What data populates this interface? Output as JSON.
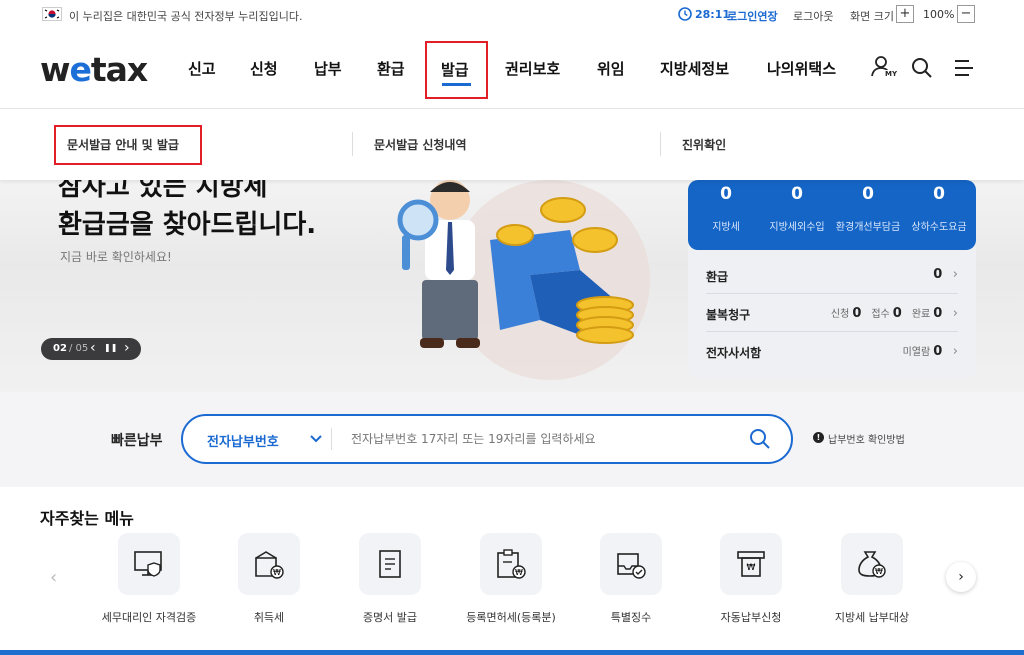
{
  "topbar": {
    "notice": "이 누리집은 대한민국 공식 전자정부 누리집입니다.",
    "timer": "28:11",
    "extend_login": "로그인연장",
    "logout": "로그아웃",
    "zoom_label": "화면 크기",
    "zoom_plus": "+",
    "zoom_value": "100%",
    "zoom_minus": "−"
  },
  "logo": {
    "w": "w",
    "e": "e",
    "tax": "tax"
  },
  "nav": [
    {
      "label": "신고"
    },
    {
      "label": "신청"
    },
    {
      "label": "납부"
    },
    {
      "label": "환급"
    },
    {
      "label": "발급"
    },
    {
      "label": "권리보호"
    },
    {
      "label": "위임"
    },
    {
      "label": "지방세정보"
    },
    {
      "label": "나의위택스"
    }
  ],
  "my_badge": "MY",
  "submenu": [
    {
      "label": "문서발급 안내 및 발급"
    },
    {
      "label": "문서발급 신청내역"
    },
    {
      "label": "진위확인"
    }
  ],
  "hero": {
    "title_top": "잠자고 있는 지방세",
    "title": "환급금을 찾아드립니다.",
    "subtitle": "지금 바로 확인하세요!",
    "slide_current": "02",
    "slide_total": "/ 05",
    "prev": "‹",
    "pause": "❚❚"
  },
  "panel": {
    "counters": [
      {
        "value": "0",
        "label": "지방세"
      },
      {
        "value": "0",
        "label": "지방세외수입"
      },
      {
        "value": "0",
        "label": "환경개선부담금"
      },
      {
        "value": "0",
        "label": "상하수도요금"
      }
    ],
    "refund": {
      "label": "환급",
      "value": "0"
    },
    "appeal": {
      "label": "불복청구",
      "apply_label": "신청",
      "apply": "0",
      "receipt_label": "접수",
      "receipt": "0",
      "done_label": "완료",
      "done": "0"
    },
    "mailbox": {
      "label": "전자사서함",
      "unread_label": "미열람",
      "unread": "0"
    }
  },
  "quickpay": {
    "label": "빠른납부",
    "select": "전자납부번호",
    "placeholder": "전자납부번호 17자리 또는 19자리를 입력하세요",
    "help": "납부번호 확인방법"
  },
  "favorites": {
    "title": "자주찾는 메뉴",
    "items": [
      {
        "label": "세무대리인 자격검증",
        "icon": "monitor-shield-icon"
      },
      {
        "label": "취득세",
        "icon": "house-won-icon"
      },
      {
        "label": "증명서 발급",
        "icon": "document-icon"
      },
      {
        "label": "등록면허세(등록분)",
        "icon": "clipboard-won-icon"
      },
      {
        "label": "특별징수",
        "icon": "inbox-check-icon"
      },
      {
        "label": "자동납부신청",
        "icon": "atm-won-icon"
      },
      {
        "label": "지방세 납부대상",
        "icon": "money-bag-icon"
      }
    ]
  },
  "colors": {
    "accent": "#1565c7",
    "highlight": "#e21e26"
  }
}
